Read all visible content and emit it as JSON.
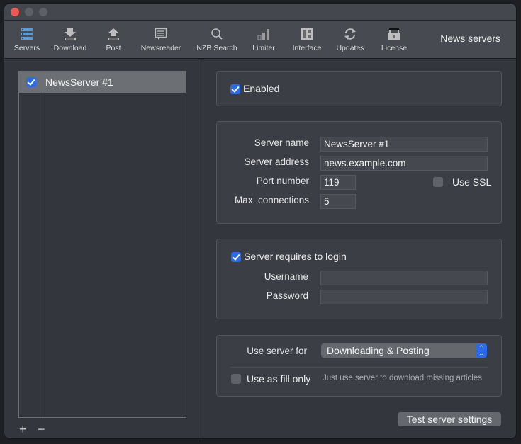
{
  "window": {
    "title": "News servers"
  },
  "toolbar": {
    "items": [
      {
        "label": "Servers",
        "icon": "servers-icon",
        "selected": true
      },
      {
        "label": "Download",
        "icon": "download-icon"
      },
      {
        "label": "Post",
        "icon": "upload-icon"
      },
      {
        "label": "Newsreader",
        "icon": "newsreader-icon"
      },
      {
        "label": "NZB Search",
        "icon": "search-icon"
      },
      {
        "label": "Limiter",
        "icon": "bar-graph-icon"
      },
      {
        "label": "Interface",
        "icon": "layout-icon"
      },
      {
        "label": "Updates",
        "icon": "refresh-icon"
      },
      {
        "label": "License",
        "icon": "lock-icon"
      }
    ],
    "section_title": "News servers"
  },
  "sidebar": {
    "servers": [
      {
        "name": "NewsServer #1",
        "enabled": true,
        "selected": true
      }
    ],
    "add_label": "+",
    "remove_label": "−"
  },
  "main": {
    "enabled": {
      "label": "Enabled",
      "checked": true
    },
    "server": {
      "name_label": "Server name",
      "name_value": "NewsServer #1",
      "address_label": "Server address",
      "address_value": "news.example.com",
      "port_label": "Port number",
      "port_value": "119",
      "ssl_label": "Use SSL",
      "ssl_checked": false,
      "connections_label": "Max. connections",
      "connections_value": "5"
    },
    "login": {
      "requires_label": "Server requires to login",
      "requires_checked": true,
      "username_label": "Username",
      "username_value": "",
      "password_label": "Password",
      "password_value": ""
    },
    "usage": {
      "use_for_label": "Use server for",
      "use_for_value": "Downloading & Posting",
      "fill_label": "Use as fill only",
      "fill_checked": false,
      "fill_hint": "Just use server to download missing articles"
    },
    "test_button": "Test server settings"
  },
  "colors": {
    "accent": "#2c6ae6",
    "selected_icon": "#5b9bd5",
    "close": "#ec5a53"
  }
}
